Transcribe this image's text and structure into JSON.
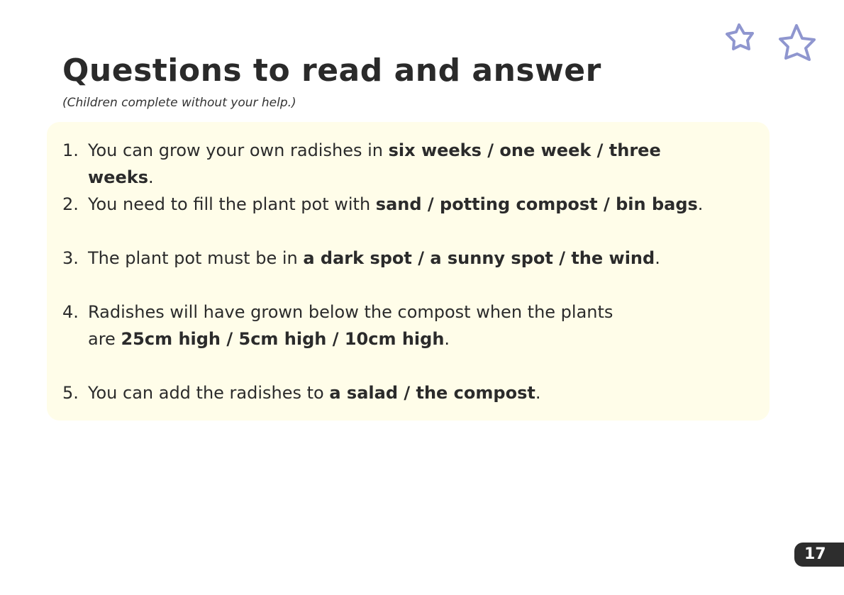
{
  "title": "Questions to read and answer",
  "subtitle": "(Children complete without your help.)",
  "questions": [
    {
      "num": "1.",
      "text": "You can grow your own radishes in ",
      "options": "six weeks / one week / three weeks",
      "end": "."
    },
    {
      "num": "2.",
      "text": "You need to fill the plant pot with ",
      "options": "sand / potting compost / bin bags",
      "end": "."
    },
    {
      "num": "3.",
      "text": "The plant pot must be in ",
      "options": "a dark spot / a sunny spot / the wind",
      "end": "."
    },
    {
      "num": "4.",
      "text": "Radishes will have grown below the compost when the plants are ",
      "options": "25cm high / 5cm high / 10cm high",
      "end": "."
    },
    {
      "num": "5.",
      "text": "You can add the radishes to ",
      "options": "a salad / the compost",
      "end": "."
    }
  ],
  "page_number": "17",
  "colors": {
    "box": "#fffde9",
    "stars": "#8f96cf",
    "page_badge": "#2d2d2d"
  }
}
